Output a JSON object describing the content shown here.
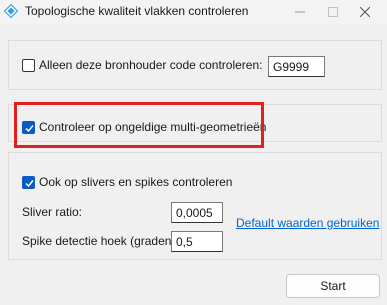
{
  "window": {
    "title": "Topologische kwaliteit vlakken controleren",
    "icon": "diamond-app-icon"
  },
  "bronhouder": {
    "checkbox_label": "Alleen deze bronhouder code controleren:",
    "checked": false,
    "code_value": "G9999"
  },
  "multigeometry": {
    "checkbox_label": "Controleer op ongeldige multi-geometrieën",
    "checked": true,
    "highlight_color": "#e02020"
  },
  "slivers": {
    "checkbox_label": "Ook op slivers en spikes controleren",
    "checked": true,
    "sliver_ratio_label": "Sliver ratio:",
    "sliver_ratio_value": "0,0005",
    "spike_angle_label": "Spike detectie hoek (graden):",
    "spike_angle_value": "0,5",
    "defaults_link": "Default waarden gebruiken"
  },
  "actions": {
    "start_label": "Start"
  },
  "colors": {
    "accent": "#0a5bc4",
    "link": "#0066cc"
  }
}
